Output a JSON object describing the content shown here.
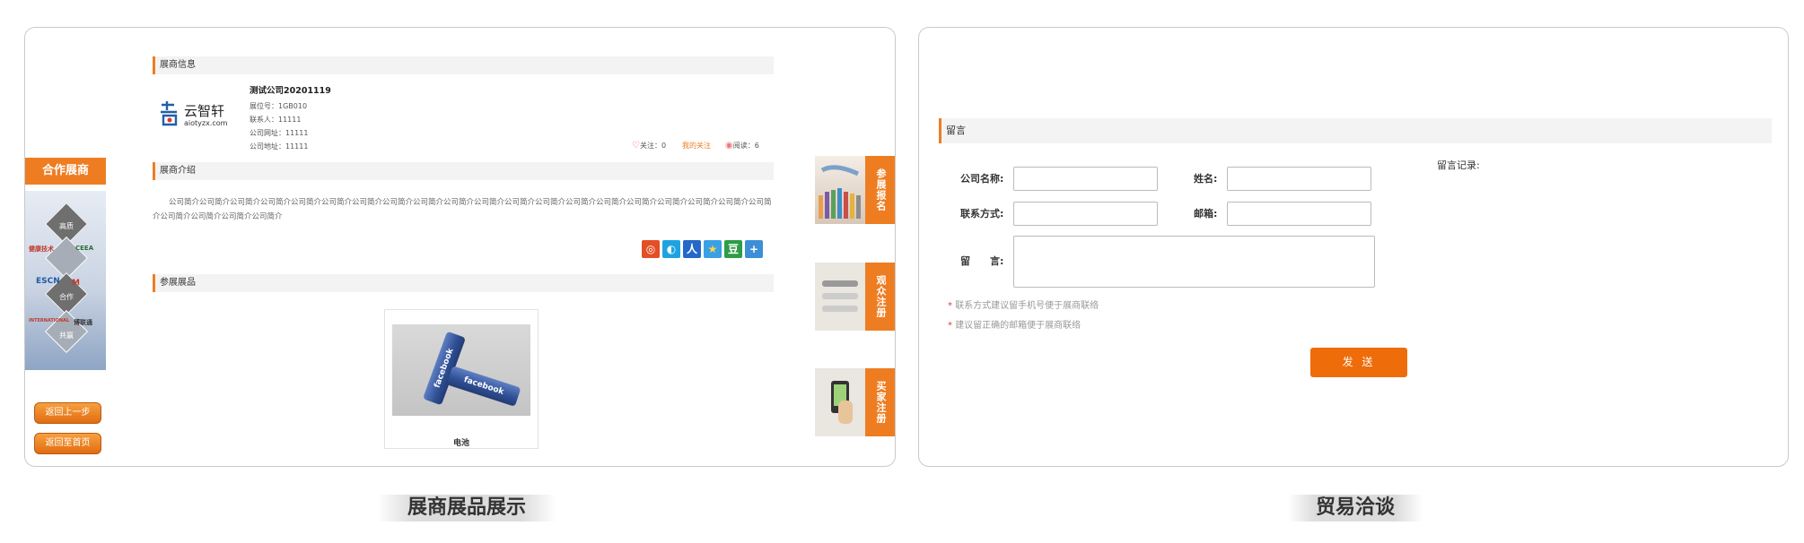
{
  "left": {
    "exhibitor_info_header": "展商信息",
    "company": {
      "logo_text": "云智轩",
      "logo_domain": "aiotyzx.com",
      "name": "测试公司20201119",
      "booth_label": "展位号：",
      "booth": "1GB010",
      "contact_label": "联系人：",
      "contact": "11111",
      "website_label": "公司网址：",
      "website": "11111",
      "address_label": "公司地址：",
      "address": "11111"
    },
    "stats": {
      "follow_label": "关注：",
      "follow_count": "0",
      "my_follow": "我的关注",
      "read_label": "阅读：",
      "read_count": "6"
    },
    "intro_header": "展商介绍",
    "intro_text": "公司简介公司简介公司简介公司简介公司简介公司简介公司简介公司简介公司简介公司简介公司简介公司简介公司简介公司简介公司简介公司简介公司简介公司简介公司简介公司简介公司简介公司简介公司简介公司简介",
    "products_header": "参展展品",
    "product": {
      "name": "电池",
      "battery_text": "facebook"
    },
    "coop_title": "合作展商",
    "coop_labels": [
      "高质",
      "合作",
      "共赢"
    ],
    "coop_brands": [
      "健康技术",
      "CEEA",
      "ESCN",
      "M",
      "INTERNATIONAL",
      "博联通"
    ],
    "back_prev": "返回上一步",
    "back_home": "返回至首页",
    "side_tabs": [
      "参展报名",
      "观众注册",
      "买家注册"
    ],
    "share_icons": [
      "weibo-icon",
      "qzone-icon",
      "renren-icon",
      "star-icon",
      "douban-icon",
      "plus-icon"
    ],
    "share_colors": [
      "#e34f24",
      "#1fa3e0",
      "#2468c8",
      "#3aa0e6",
      "#2d9d48",
      "#3c8fd6"
    ]
  },
  "right": {
    "message_header": "留言",
    "company_name_label": "公司名称:",
    "name_label": "姓名:",
    "contact_label": "联系方式:",
    "email_label": "邮箱:",
    "message_label": "留　　言:",
    "record_label": "留言记录:",
    "note1": "联系方式建议留手机号便于展商联络",
    "note2": "建议留正确的邮箱便于展商联络",
    "send_label": "发 送"
  },
  "captions": {
    "left": "展商展品展示",
    "right": "贸易洽谈"
  },
  "colors": {
    "accent": "#ee7d22",
    "send": "#ef6c0a"
  }
}
